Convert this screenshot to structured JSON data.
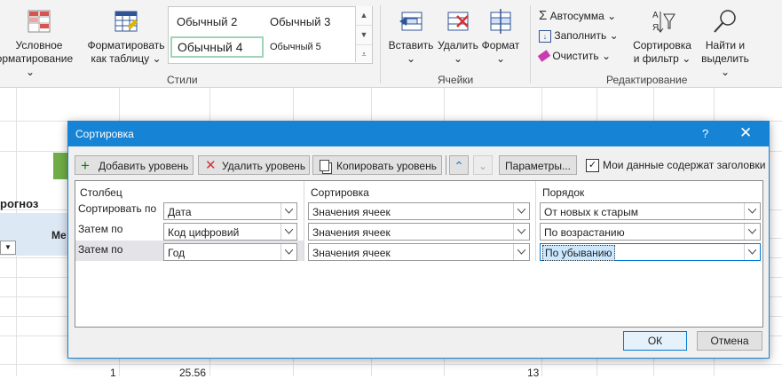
{
  "ribbon": {
    "conditional_format": {
      "line1": "Условное",
      "line2": "форматирование"
    },
    "format_table": {
      "line1": "Форматировать",
      "line2": "как таблицу"
    },
    "styles": [
      "Обычный 2",
      "Обычный 3",
      "Обычный 4",
      "Обычный 5"
    ],
    "styles_group_label": "Стили",
    "cells": {
      "insert": "Вставить",
      "delete": "Удалить",
      "format": "Формат",
      "group_label": "Ячейки"
    },
    "editing": {
      "autosum": "Автосумма",
      "fill": "Заполнить",
      "clear": "Очистить",
      "sort_filter": {
        "line1": "Сортировка",
        "line2": "и фильтр"
      },
      "find_select": {
        "line1": "Найти и",
        "line2": "выделить"
      },
      "group_label": "Редактирование"
    }
  },
  "sheet": {
    "header_partial": "рогноз",
    "col_partial": "Ме",
    "row_values": [
      {
        "a": "1",
        "b": "25.56",
        "c": "13"
      }
    ]
  },
  "dialog": {
    "title": "Сортировка",
    "help": "?",
    "close": "✕",
    "toolbar": {
      "add_level": "Добавить уровень",
      "delete_level": "Удалить уровень",
      "copy_level": "Копировать уровень",
      "options": "Параметры...",
      "headers_checkbox": "Мои данные содержат заголовки",
      "headers_checked": true
    },
    "headers": {
      "column": "Столбец",
      "sort_on": "Сортировка",
      "order": "Порядок"
    },
    "rows": [
      {
        "label": "Сортировать по",
        "column": "Дата",
        "sort_on": "Значения ячеек",
        "order": "От новых к старым"
      },
      {
        "label": "Затем по",
        "column": "Код цифровий",
        "sort_on": "Значения ячеек",
        "order": "По возрастанию"
      },
      {
        "label": "Затем по",
        "column": "Год",
        "sort_on": "Значения ячеек",
        "order": "По убыванию"
      }
    ],
    "ok": "ОК",
    "cancel": "Отмена"
  },
  "colors": {
    "accent": "#1783d4",
    "selection": "#cce8ff"
  }
}
